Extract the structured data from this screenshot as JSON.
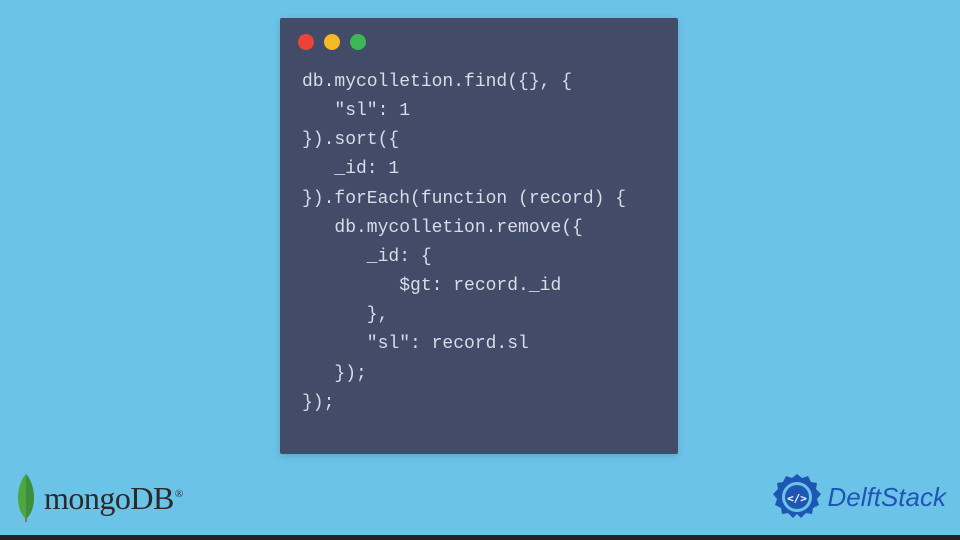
{
  "code": {
    "lines": [
      "db.mycolletion.find({}, {",
      "   \"sl\": 1",
      "}).sort({",
      "   _id: 1",
      "}).forEach(function (record) {",
      "   db.mycolletion.remove({",
      "      _id: {",
      "         $gt: record._id",
      "      },",
      "      \"sl\": record.sl",
      "   });",
      "});"
    ]
  },
  "logos": {
    "mongodb": "mongoDB",
    "mongodb_reg": "®",
    "delftstack": "DelftStack"
  }
}
